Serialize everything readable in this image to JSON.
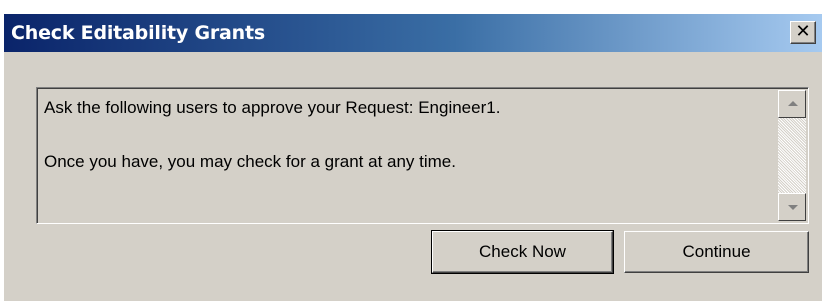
{
  "window": {
    "title": "Check Editability Grants",
    "close_glyph": "✕"
  },
  "message": {
    "line1": "Ask the following users to approve your Request: Engineer1.",
    "line2": "Once you have, you may check for a grant at any time."
  },
  "buttons": {
    "check_now": "Check Now",
    "continue": "Continue"
  },
  "icons": {
    "close": "close-icon",
    "scroll_up": "scroll-up-arrow-icon",
    "scroll_down": "scroll-down-arrow-icon"
  },
  "colors": {
    "titlebar_start": "#0a246a",
    "titlebar_end": "#a6caf0",
    "dialog_bg": "#d4d0c8"
  }
}
